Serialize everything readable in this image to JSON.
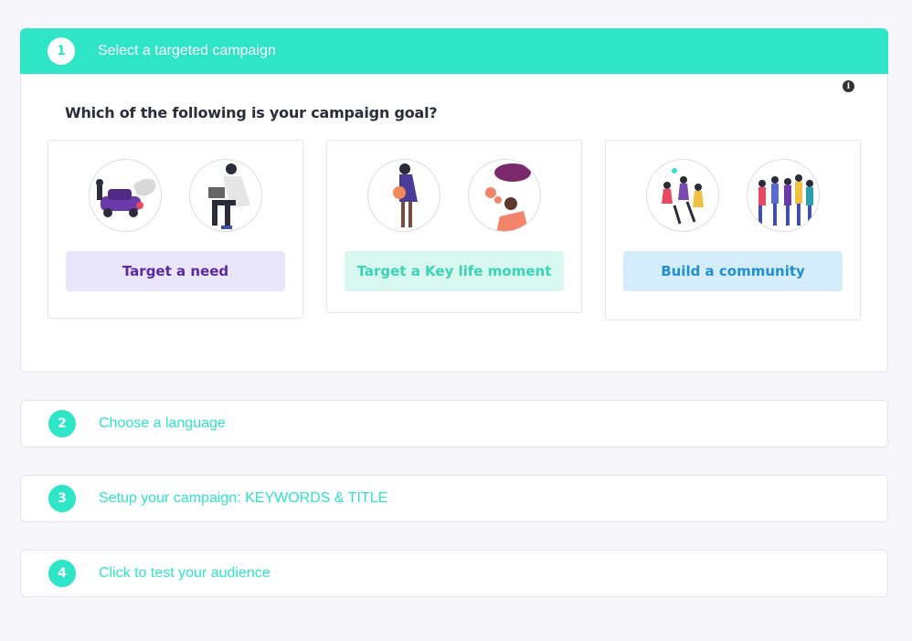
{
  "steps": [
    {
      "number": "1",
      "title": "Select a targeted campaign"
    },
    {
      "number": "2",
      "title": "Choose a language"
    },
    {
      "number": "3",
      "title": "Setup your campaign: KEYWORDS & TITLE"
    },
    {
      "number": "4",
      "title": "Click to test your audience"
    }
  ],
  "step1": {
    "question": "Which of the following is your campaign goal?",
    "info_icon": "info-icon",
    "options": [
      {
        "label": "Target a need"
      },
      {
        "label": "Target a Key life moment"
      },
      {
        "label": "Build a community"
      }
    ]
  },
  "colors": {
    "accent": "#2ee5c7",
    "need": "#5b2aa0",
    "life": "#3ad3b6",
    "community": "#1f8fd4"
  }
}
